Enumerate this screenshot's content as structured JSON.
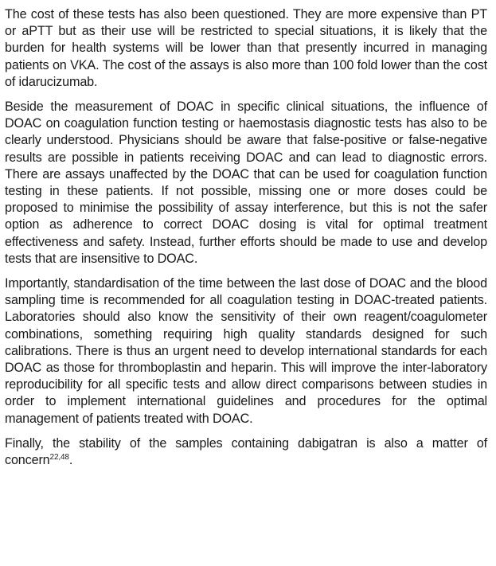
{
  "document": {
    "paragraphs": [
      {
        "text": "The cost of these tests has also been questioned. They are more expensive than PT or aPTT but as their use will be restricted to special situations, it is likely that the burden for health systems will be lower than that presently incurred in managing patients on VKA. The cost of the assays is also more than 100 fold lower than the cost of idarucizumab."
      },
      {
        "text": "Beside the measurement of DOAC in specific clinical situations, the influence of DOAC on coagulation function testing or haemostasis diagnostic tests has also to be clearly understood. Physicians should be aware that false-positive or false-negative results are possible in patients receiving DOAC and can lead to diagnostic errors. There are assays unaffected by the DOAC that can be used for coagulation function testing in these patients. If not possible, missing one or more doses could be proposed to minimise the possibility of assay interference, but this is not the safer option as adherence to correct DOAC dosing is vital for optimal treatment effectiveness and safety. Instead, further efforts should be made to use and develop tests that are insensitive to DOAC."
      },
      {
        "text": "Importantly, standardisation of the time between the last dose of DOAC and the blood sampling time is recommended for all coagulation testing in DOAC-treated patients. Laboratories should also know the sensitivity of their own reagent/coagulometer combinations, something requiring high quality standards designed for such calibrations. There is thus an urgent need to develop international standards for each DOAC as those for thromboplastin and heparin. This will improve the inter-laboratory reproducibility for all specific tests and allow direct comparisons between studies in order to implement international guidelines and procedures for the optimal management of patients treated with DOAC."
      },
      {
        "text": "Finally, the stability of the samples containing dabigatran is also a matter of concern",
        "ref": "22,48",
        "tail": "."
      }
    ]
  }
}
